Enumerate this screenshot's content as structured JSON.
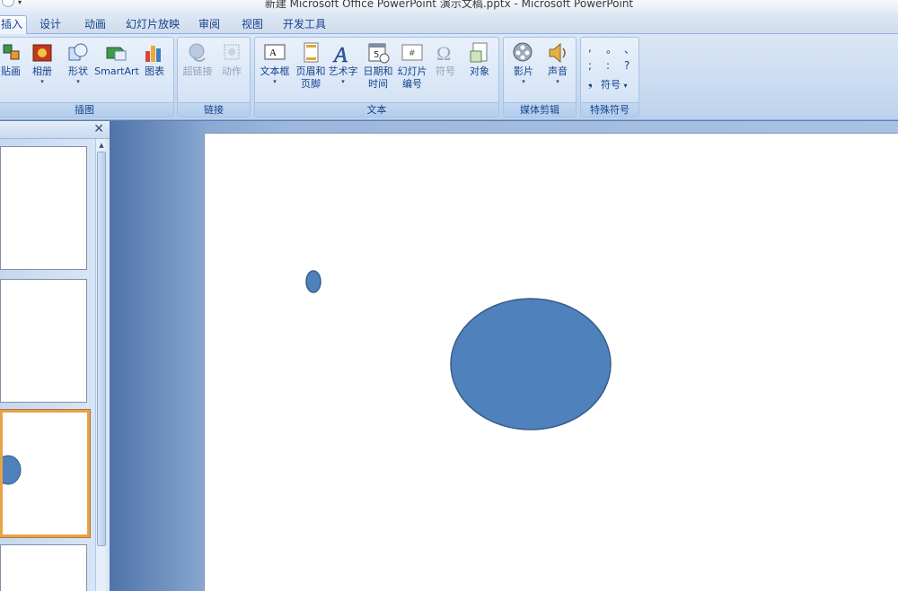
{
  "window": {
    "title": "新建 Microsoft Office PowerPoint 演示文稿.pptx - Microsoft PowerPoint"
  },
  "tabs": [
    {
      "label": "插入",
      "active": true
    },
    {
      "label": "设计"
    },
    {
      "label": "动画"
    },
    {
      "label": "幻灯片放映"
    },
    {
      "label": "审阅"
    },
    {
      "label": "视图"
    },
    {
      "label": "开发工具"
    }
  ],
  "ribbon": {
    "groups": {
      "illustrations": "插图",
      "links": "链接",
      "text": "文本",
      "media": "媒体剪辑",
      "special": "特殊符号"
    },
    "buttons": {
      "clipart": "贴画",
      "album": "相册",
      "shapes": "形状",
      "smartart": "SmartArt",
      "chart": "图表",
      "hyperlink": "超链接",
      "action": "动作",
      "textbox": "文本框",
      "header_footer_1": "页眉和",
      "header_footer_2": "页脚",
      "wordart": "艺术字",
      "datetime_1": "日期和",
      "datetime_2": "时间",
      "slidenum_1": "幻灯片",
      "slidenum_2": "编号",
      "symbol": "符号",
      "object": "对象",
      "movie": "影片",
      "sound": "声音",
      "symbol_menu": "符号"
    },
    "special_symbols": [
      ",",
      "。",
      "、",
      ";",
      ":",
      "?",
      "❟"
    ]
  },
  "icons": {
    "close": "✕",
    "scroll_up": "▲",
    "dropdown": "▾"
  },
  "colors": {
    "shape_fill": "#4f81bd",
    "shape_stroke": "#385d8a",
    "selected_thumb": "#e7a34a"
  }
}
